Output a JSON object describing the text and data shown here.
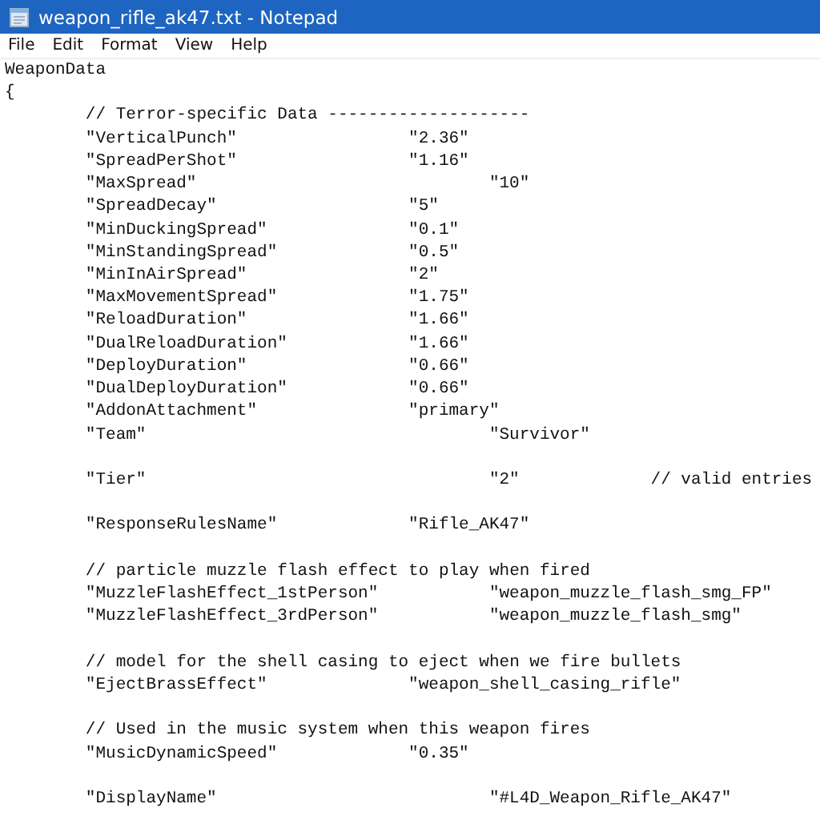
{
  "window": {
    "title": "weapon_rifle_ak47.txt - Notepad"
  },
  "menu": [
    "File",
    "Edit",
    "Format",
    "View",
    "Help"
  ],
  "lines": [
    {
      "kind": "code",
      "text": "WeaponData"
    },
    {
      "kind": "code",
      "text": "{"
    },
    {
      "kind": "code",
      "text": "\t// Terror-specific Data --------------------"
    },
    {
      "kind": "code",
      "text": "\t\"VerticalPunch\"\t\t\t\"2.36\""
    },
    {
      "kind": "code",
      "text": "\t\"SpreadPerShot\"\t\t\t\"1.16\""
    },
    {
      "kind": "code",
      "text": "\t\"MaxSpread\"\t\t\t\t\"10\""
    },
    {
      "kind": "code",
      "text": "\t\"SpreadDecay\"\t\t\t\"5\""
    },
    {
      "kind": "code",
      "text": "\t\"MinDuckingSpread\"\t\t\"0.1\""
    },
    {
      "kind": "code",
      "text": "\t\"MinStandingSpread\"\t\t\"0.5\""
    },
    {
      "kind": "code",
      "text": "\t\"MinInAirSpread\"\t\t\"2\""
    },
    {
      "kind": "code",
      "text": "\t\"MaxMovementSpread\"\t\t\"1.75\""
    },
    {
      "kind": "code",
      "text": "\t\"ReloadDuration\"\t\t\"1.66\""
    },
    {
      "kind": "code",
      "text": "\t\"DualReloadDuration\"\t\t\"1.66\""
    },
    {
      "kind": "code",
      "text": "\t\"DeployDuration\"\t\t\"0.66\""
    },
    {
      "kind": "code",
      "text": "\t\"DualDeployDuration\"\t\t\"0.66\""
    },
    {
      "kind": "code",
      "text": "\t\"AddonAttachment\"\t\t\"primary\""
    },
    {
      "kind": "code",
      "text": "\t\"Team\"\t\t\t\t\t\"Survivor\""
    },
    {
      "kind": "blank"
    },
    {
      "kind": "code",
      "text": "\t\"Tier\"\t\t\t\t\t\"2\"\t\t// valid entries"
    },
    {
      "kind": "blank"
    },
    {
      "kind": "code",
      "text": "\t\"ResponseRulesName\"\t\t\"Rifle_AK47\""
    },
    {
      "kind": "blank"
    },
    {
      "kind": "code",
      "text": "\t// particle muzzle flash effect to play when fired"
    },
    {
      "kind": "code",
      "text": "\t\"MuzzleFlashEffect_1stPerson\"\t\t\"weapon_muzzle_flash_smg_FP\""
    },
    {
      "kind": "code",
      "text": "\t\"MuzzleFlashEffect_3rdPerson\"\t\t\"weapon_muzzle_flash_smg\""
    },
    {
      "kind": "blank"
    },
    {
      "kind": "code",
      "text": "\t// model for the shell casing to eject when we fire bullets"
    },
    {
      "kind": "code",
      "text": "\t\"EjectBrassEffect\"\t\t\"weapon_shell_casing_rifle\""
    },
    {
      "kind": "blank"
    },
    {
      "kind": "code",
      "text": "\t// Used in the music system when this weapon fires"
    },
    {
      "kind": "code",
      "text": "\t\"MusicDynamicSpeed\"\t\t\"0.35\""
    },
    {
      "kind": "blank"
    },
    {
      "kind": "code",
      "text": "\t\"DisplayName\"\t\t\t\t\"#L4D_Weapon_Rifle_AK47\""
    }
  ]
}
